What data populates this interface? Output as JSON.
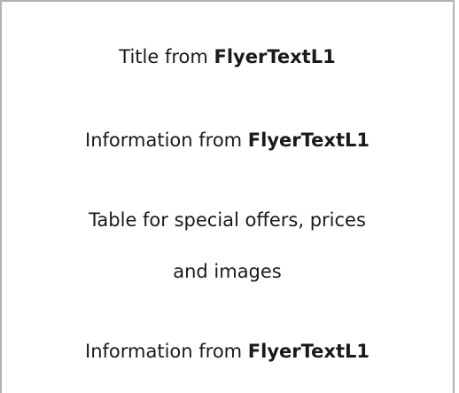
{
  "document": {
    "line1": {
      "text": "Title from ",
      "bold": "FlyerTextL1"
    },
    "line2": {
      "text": "Information from ",
      "bold": "FlyerTextL1"
    },
    "line3": {
      "text": "Table for special offers, prices"
    },
    "line4": {
      "text": "and images"
    },
    "line5": {
      "text": "Information from ",
      "bold": "FlyerTextL1"
    }
  },
  "colors": {
    "border": "#b3b3b3",
    "text": "#1a1a1a",
    "background": "#ffffff"
  }
}
